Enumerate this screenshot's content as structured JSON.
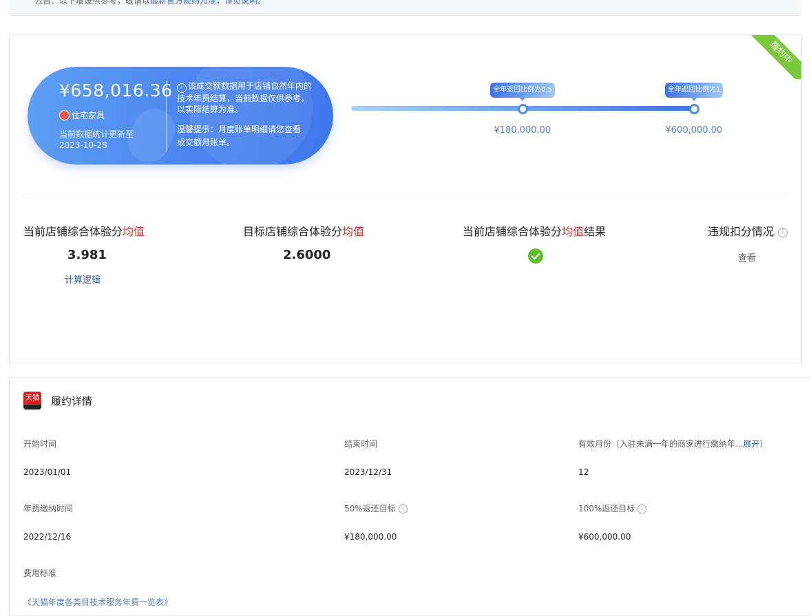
{
  "top_notice": {
    "text": "公告：以下增设供参考，敬请以",
    "link": "最新官方规则为准，详见说明。"
  },
  "contract": {
    "status_ribbon": "履约中",
    "amount": "¥658,016.36",
    "category": "住宅家具",
    "updated_label": "当前数据统计更新至",
    "updated_date": "2023-10-28",
    "note1": "该成交额数据用于店铺自然年内的技术年费结算，当前数据仅供参考，以实际结算为准。",
    "note2": "温馨提示：月度账单明细请您查看成交额月账单。",
    "milestones": [
      {
        "tag": "全年返回比例为0.5",
        "value": "¥180,000.00",
        "fraction": 0.5
      },
      {
        "tag": "全年返回比例为1",
        "value": "¥600,000.00",
        "fraction": 1
      }
    ]
  },
  "stats": {
    "current_label": "当前店铺综合体验分",
    "target_label": "目标店铺综合体验分",
    "result_label": "当前店铺综合体验分",
    "avg_word": "均值",
    "result_suffix": "结果",
    "violation_label": "违规扣分情况",
    "current_value": "3.981",
    "target_value": "2.6000",
    "calc_logic": "计算逻辑",
    "view": "查看"
  },
  "details": {
    "title": "履约详情",
    "logo_text": "天猫",
    "fields": [
      {
        "label": "开始时间",
        "value": "2023/01/01"
      },
      {
        "label": "结束时间",
        "value": "2023/12/31"
      },
      {
        "label": "有效月份（入驻未满一年的商家进行缴纳年...",
        "expand": "展开",
        "value": "12"
      },
      {
        "label": "年费缴纳时间",
        "value": "2022/12/16"
      },
      {
        "label": "50%返还目标",
        "value": "¥180,000.00"
      },
      {
        "label": "100%返还目标",
        "value": "¥600,000.00"
      }
    ],
    "fee_label": "费用标准",
    "fee_link": "《天猫年度各类目技术服务年费一览表》"
  },
  "colors": {
    "accent": "#4b84ee",
    "ribbon": "#7ac93a",
    "highlight_red": "#e02d2d",
    "success": "#5fbf2d"
  }
}
